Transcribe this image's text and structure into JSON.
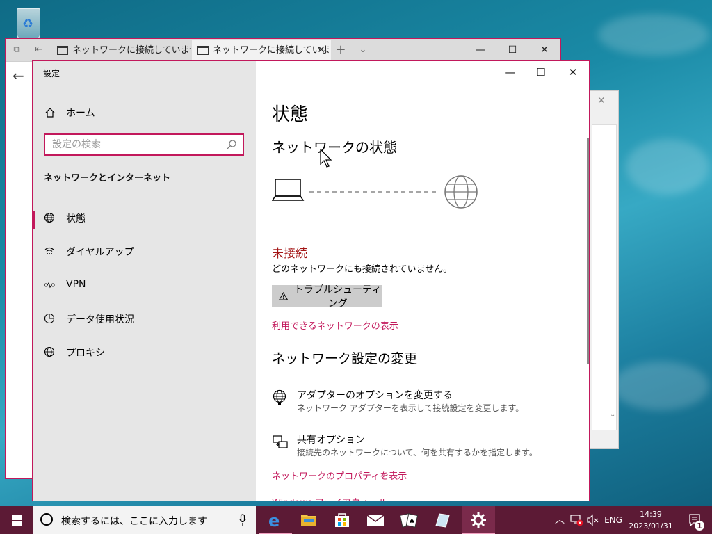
{
  "edge": {
    "tab1_title": "ネットワークに接続していません",
    "tab2_title": "ネットワークに接続していま!"
  },
  "settings": {
    "window_title": "設定",
    "home_label": "ホーム",
    "search_placeholder": "設定の検索",
    "section_title": "ネットワークとインターネット",
    "nav": [
      {
        "label": "状態"
      },
      {
        "label": "ダイヤルアップ"
      },
      {
        "label": "VPN"
      },
      {
        "label": "データ使用状況"
      },
      {
        "label": "プロキシ"
      }
    ],
    "main": {
      "title": "状態",
      "network_status_heading": "ネットワークの状態",
      "status": "未接続",
      "status_desc": "どのネットワークにも接続されていません。",
      "troubleshoot_label": "トラブルシューティング",
      "show_networks_link": "利用できるネットワークの表示",
      "change_heading": "ネットワーク設定の変更",
      "options": [
        {
          "title": "アダプターのオプションを変更する",
          "desc": "ネットワーク アダプターを表示して接続設定を変更します。"
        },
        {
          "title": "共有オプション",
          "desc": "接続先のネットワークについて、何を共有するかを指定します。"
        }
      ],
      "properties_link": "ネットワークのプロパティを表示",
      "firewall_link": "Windows ファイアウォール"
    }
  },
  "taskbar": {
    "search_text": "検索するには、ここに入力します",
    "lang": "ENG",
    "time": "14:39",
    "date": "2023/01/31",
    "notification_count": "1"
  },
  "colors": {
    "accent": "#c2185b",
    "status_red": "#a31515",
    "taskbar": "#5c1a35"
  }
}
